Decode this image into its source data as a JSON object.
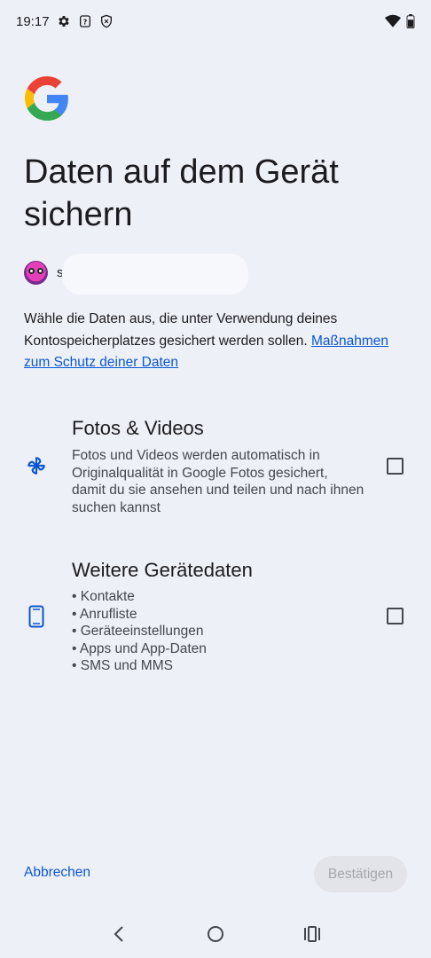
{
  "status_bar": {
    "time": "19:17",
    "icons": [
      "gear-icon",
      "question-icon",
      "shield-icon",
      "wifi-icon",
      "battery-icon"
    ]
  },
  "brand": {
    "logo": "google-g-logo",
    "colors": {
      "blue": "#4285F4",
      "red": "#EA4335",
      "yellow": "#FBBC05",
      "green": "#34A853"
    }
  },
  "page": {
    "title": "Daten auf dem Gerät sichern",
    "account_initial": "s",
    "description": "Wähle die Daten aus, die unter Verwendung deines Kontospeicherplatzes gesichert werden sollen.",
    "link": "Maßnahmen zum Schutz deiner Daten"
  },
  "options": [
    {
      "icon": "pinwheel-icon",
      "title": "Fotos & Videos",
      "text": "Fotos und Videos werden automatisch in Originalqualität in Google Fotos gesichert, damit du sie ansehen und teilen und nach ihnen suchen kannst",
      "checked": false
    },
    {
      "icon": "phone-icon",
      "title": "Weitere Gerätedaten",
      "items": [
        "• Kontakte",
        "• Anrufliste",
        "• Geräteeinstellungen",
        "• Apps und App-Daten",
        "• SMS und MMS"
      ],
      "checked": false
    }
  ],
  "actions": {
    "cancel": "Abbrechen",
    "confirm": "Bestätigen"
  },
  "accent": "#0b57d0",
  "nav": [
    "back-icon",
    "home-icon",
    "recents-icon"
  ]
}
